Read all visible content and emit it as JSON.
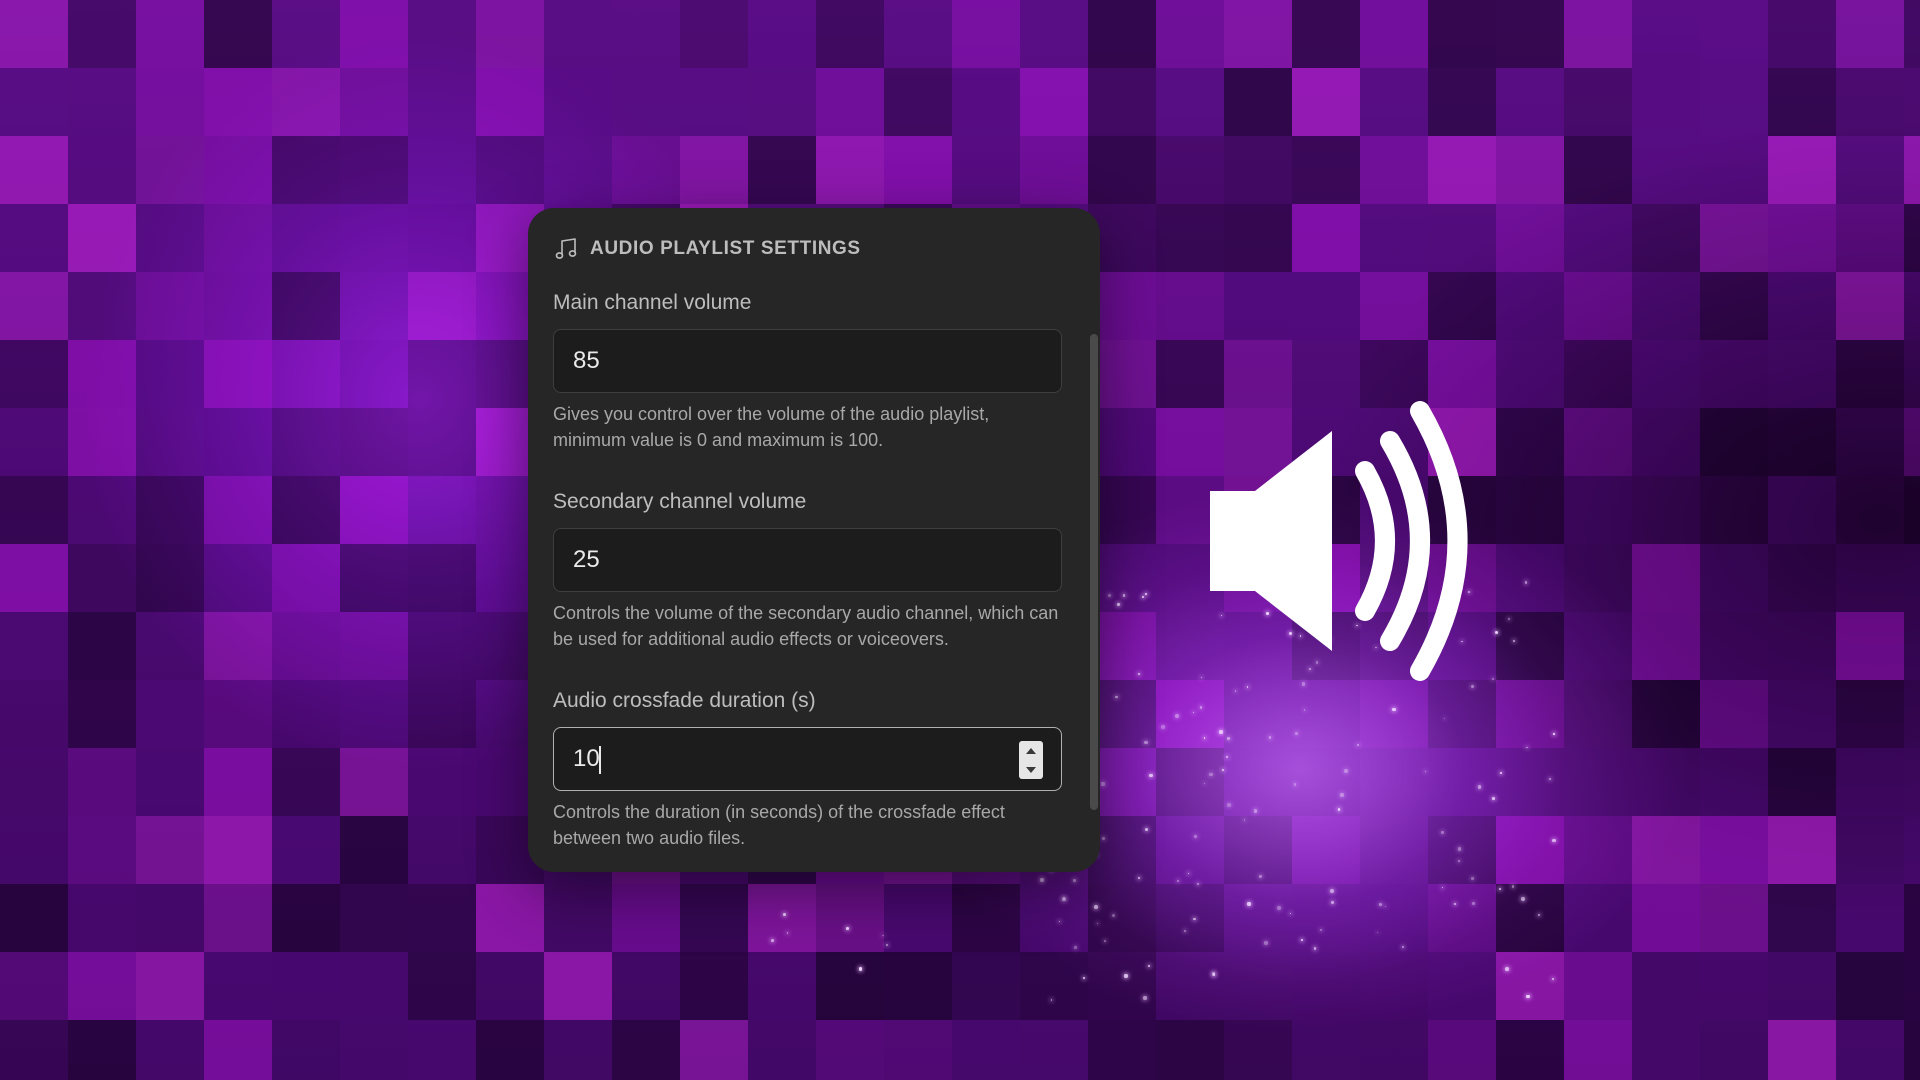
{
  "panel": {
    "icon": "music-note-icon",
    "title": "AUDIO PLAYLIST SETTINGS"
  },
  "fields": [
    {
      "label": "Main channel volume",
      "value": "85",
      "help": "Gives you control over the volume of the audio playlist, minimum value is 0 and maximum is 100."
    },
    {
      "label": "Secondary channel volume",
      "value": "25",
      "help": "Controls the volume of the secondary audio channel, which can be used for additional audio effects or voiceovers."
    },
    {
      "label": "Audio crossfade duration (s)",
      "value": "10",
      "help": "Controls the duration (in seconds) of the crossfade effect between two audio files."
    }
  ],
  "decor": {
    "speaker_icon": "speaker-volume-icon",
    "colors": {
      "panel": "#262626",
      "background_purple": "#5b0f86",
      "accent_magenta": "#c21ee0"
    }
  }
}
